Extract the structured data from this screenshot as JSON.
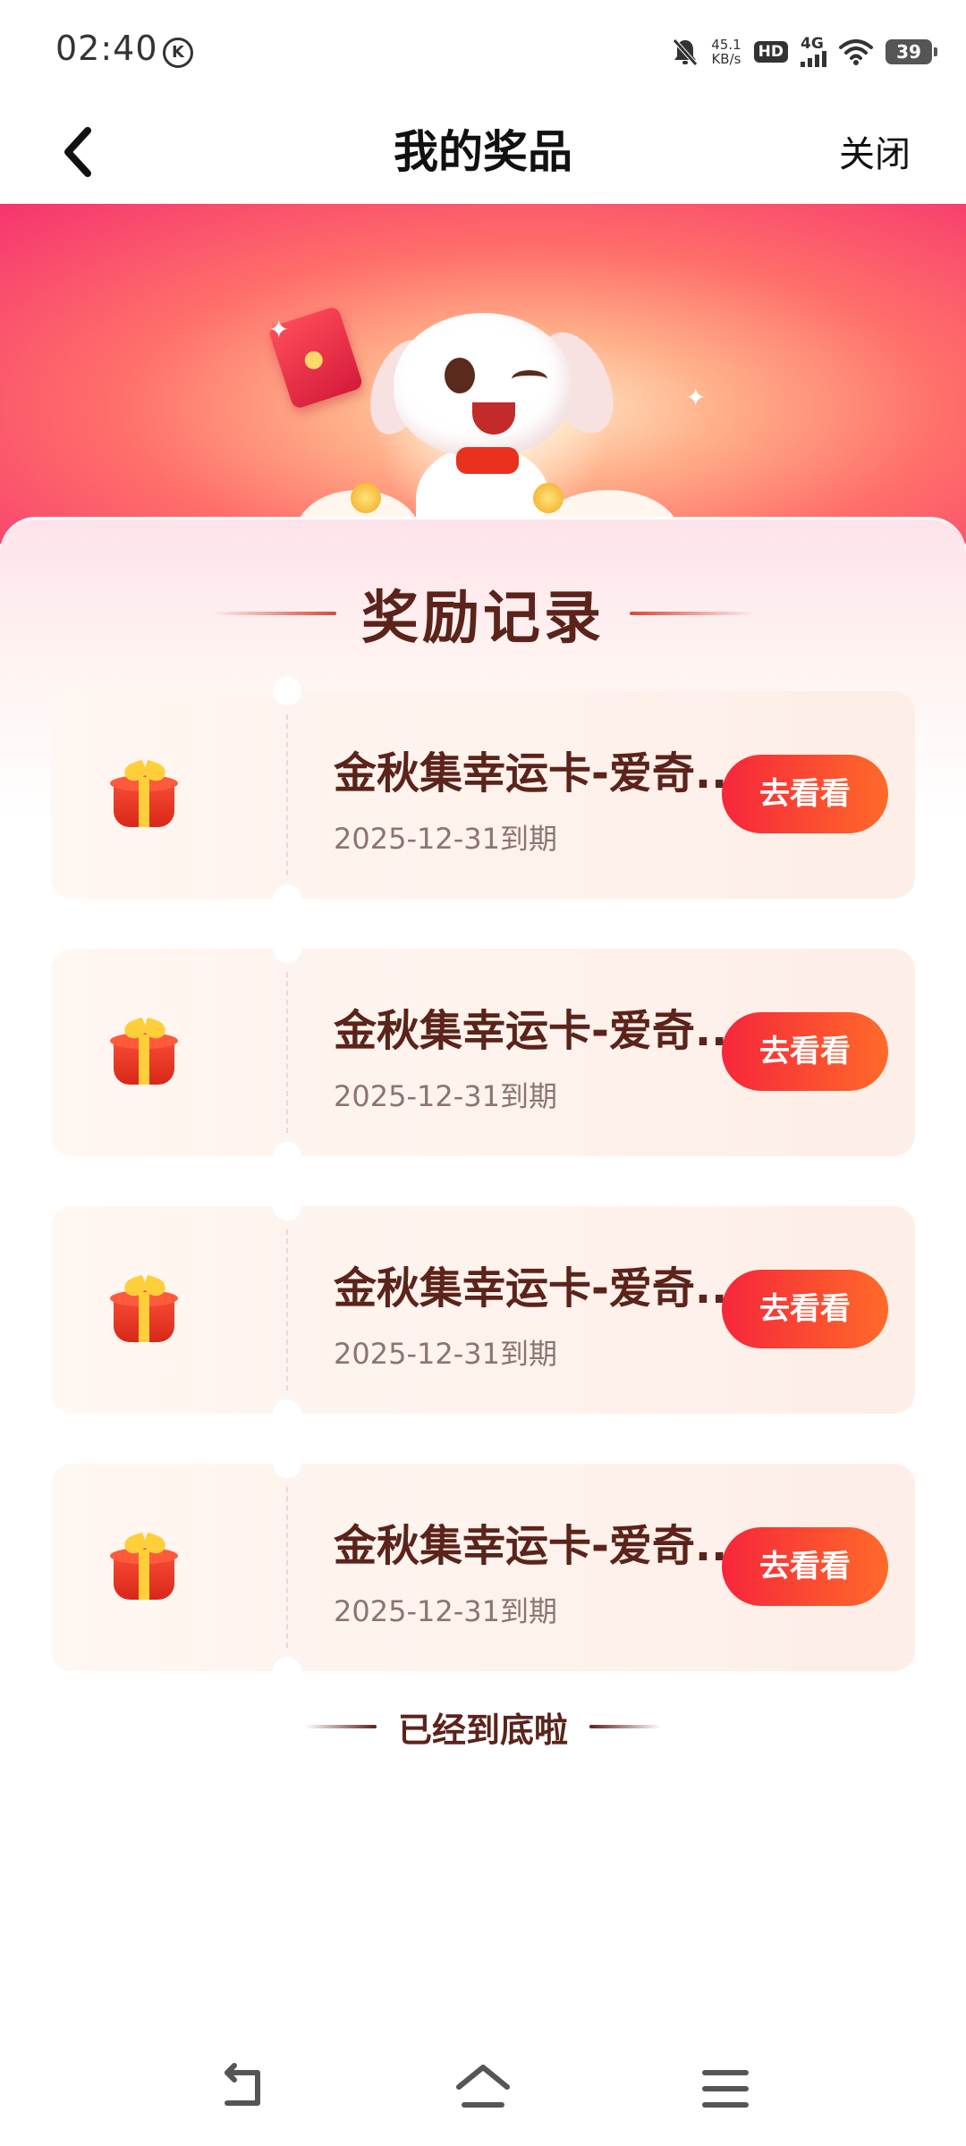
{
  "status_bar": {
    "time": "02:40",
    "k_badge": "K",
    "net_speed_value": "45.1",
    "net_speed_unit": "KB/s",
    "hd_label": "HD",
    "network_label": "4G",
    "battery_level": "39"
  },
  "nav": {
    "title": "我的奖品",
    "close_label": "关闭",
    "back_icon": "chevron-left-icon"
  },
  "section": {
    "title": "奖励记录"
  },
  "prizes": [
    {
      "name": "金秋集幸运卡-爱奇...",
      "expiry": "2025-12-31到期",
      "button_label": "去看看",
      "icon": "gift-box-icon"
    },
    {
      "name": "金秋集幸运卡-爱奇...",
      "expiry": "2025-12-31到期",
      "button_label": "去看看",
      "icon": "gift-box-icon"
    },
    {
      "name": "金秋集幸运卡-爱奇...",
      "expiry": "2025-12-31到期",
      "button_label": "去看看",
      "icon": "gift-box-icon"
    },
    {
      "name": "金秋集幸运卡-爱奇...",
      "expiry": "2025-12-31到期",
      "button_label": "去看看",
      "icon": "gift-box-icon"
    }
  ],
  "footer": {
    "end_text": "已经到底啦"
  },
  "system_nav": {
    "back_icon": "back-arrow-icon",
    "home_icon": "home-icon",
    "menu_icon": "menu-icon"
  },
  "colors": {
    "accent_red": "#f6263a",
    "accent_orange": "#ff6a2a",
    "title_brown": "#5b231a",
    "banner_pink": "#f6346f"
  }
}
